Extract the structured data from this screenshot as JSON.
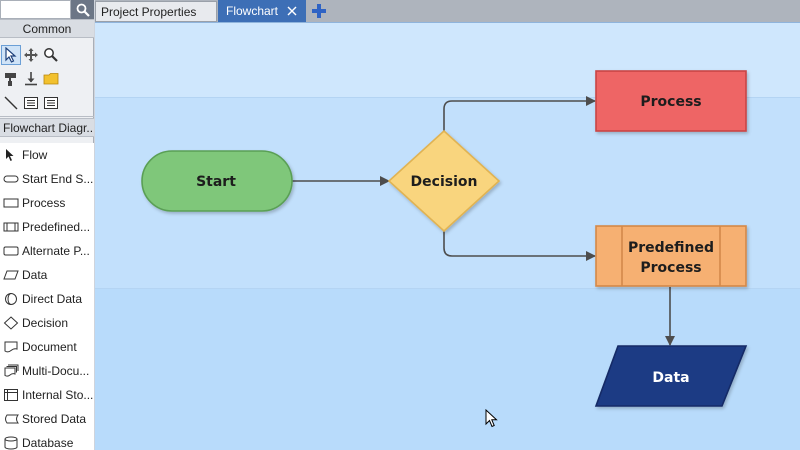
{
  "search": {
    "placeholder": ""
  },
  "panel": {
    "common_header": "Common",
    "flowchart_header": "Flowchart Diagr...",
    "shapes": [
      {
        "label": "Flow",
        "icon": "flow-arrow-icon"
      },
      {
        "label": "Start End S...",
        "icon": "start-end-icon"
      },
      {
        "label": "Process",
        "icon": "process-icon"
      },
      {
        "label": "Predefined...",
        "icon": "predefined-process-icon"
      },
      {
        "label": "Alternate P...",
        "icon": "alternate-process-icon"
      },
      {
        "label": "Data",
        "icon": "data-icon"
      },
      {
        "label": "Direct Data",
        "icon": "direct-data-icon"
      },
      {
        "label": "Decision",
        "icon": "decision-icon"
      },
      {
        "label": "Document",
        "icon": "document-icon"
      },
      {
        "label": "Multi-Docu...",
        "icon": "multi-document-icon"
      },
      {
        "label": "Internal Sto...",
        "icon": "internal-storage-icon"
      },
      {
        "label": "Stored Data",
        "icon": "stored-data-icon"
      },
      {
        "label": "Database",
        "icon": "database-icon"
      }
    ]
  },
  "tabs": {
    "project_properties": "Project Properties",
    "flowchart": "Flowchart"
  },
  "diagram": {
    "start": "Start",
    "decision": "Decision",
    "process": "Process",
    "predefined_line1": "Predefined",
    "predefined_line2": "Process",
    "data": "Data"
  },
  "colors": {
    "start_fill": "#7fc77a",
    "decision_fill": "#f9d57e",
    "process_fill": "#ee6565",
    "predefined_fill": "#f6b072",
    "data_fill": "#1e3a84",
    "active_tab": "#3d6fb6",
    "canvas": "#c2e0fc"
  }
}
